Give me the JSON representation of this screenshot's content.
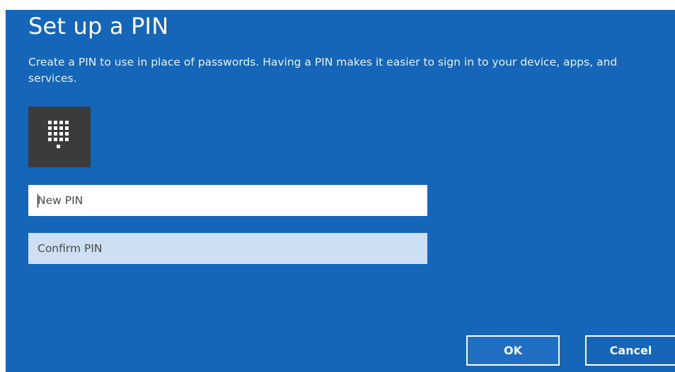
{
  "dialog": {
    "title": "Set up a PIN",
    "description": "Create a PIN to use in place of passwords. Having a PIN makes it easier to sign in to your device, apps, and services.",
    "background_color": "#1565b8",
    "pin_icon": "keypad-icon"
  },
  "fields": {
    "new_pin": {
      "placeholder": "New PIN",
      "value": ""
    },
    "confirm_pin": {
      "placeholder": "Confirm PIN",
      "value": ""
    }
  },
  "buttons": {
    "ok_label": "OK",
    "cancel_label": "Cancel"
  }
}
